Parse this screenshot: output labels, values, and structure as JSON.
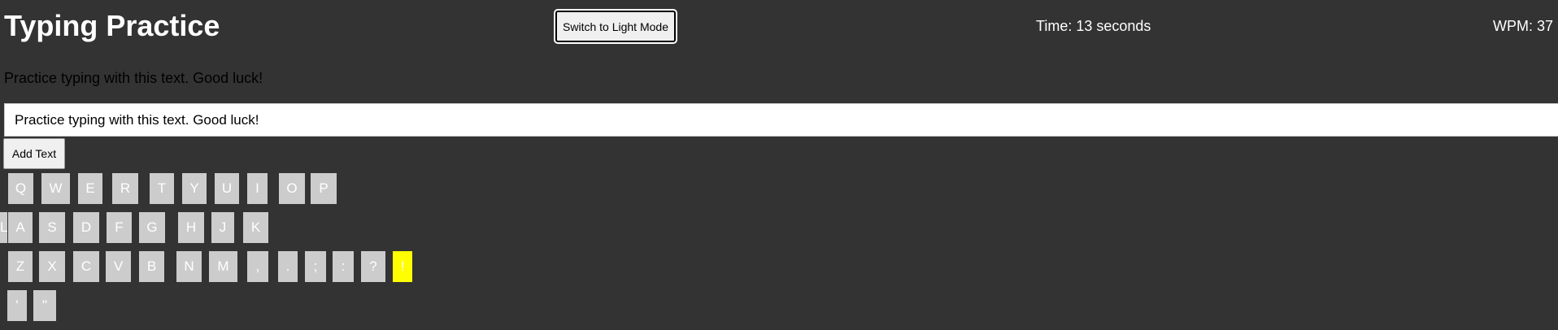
{
  "header": {
    "title": "Typing Practice",
    "mode_button_label": "Switch to Light Mode",
    "timer_text": "Time: 13 seconds",
    "wpm_text": "WPM: 37"
  },
  "practice": {
    "sample_text": "Practice typing with this text. Good luck!",
    "input_value": "Practice typing with this text. Good luck!",
    "add_button_label": "Add Text"
  },
  "keyboard": {
    "rows": [
      [
        "Q",
        "W",
        "E",
        "R",
        "T",
        "Y",
        "U",
        "I",
        "O",
        "P"
      ],
      [
        "A",
        "S",
        "D",
        "F",
        "G",
        "H",
        "J",
        "K",
        "L"
      ],
      [
        "Z",
        "X",
        "C",
        "V",
        "B",
        "N",
        "M",
        ",",
        ".",
        ";",
        ":",
        "?",
        "!"
      ],
      [
        "'",
        "\""
      ]
    ],
    "active_key": "!",
    "key_color": "#cccccc",
    "active_key_color": "#ffff00"
  },
  "theme": {
    "background": "#333333",
    "text": "#ffffff"
  }
}
